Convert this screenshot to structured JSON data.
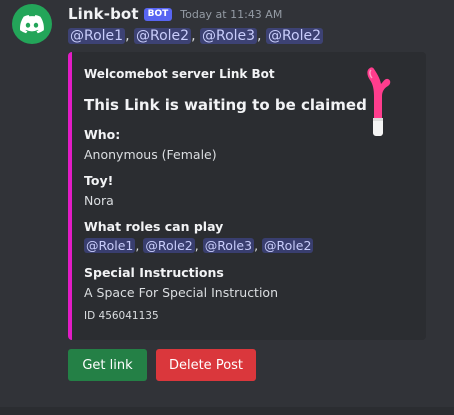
{
  "message": {
    "username": "Link-bot",
    "bot_badge": "BOT",
    "timestamp": "Today at 11:43 AM",
    "mentions": [
      "@Role1",
      "@Role2",
      "@Role3",
      "@Role2"
    ],
    "separator": ", "
  },
  "embed": {
    "accent_color": "#e21cc5",
    "author": "Welcomebot server Link Bot",
    "title": "This Link is waiting to be claimed",
    "fields": {
      "who": {
        "name": "Who:",
        "value": "Anonymous (Female)"
      },
      "toy": {
        "name": "Toy!",
        "value": "Nora"
      },
      "roles": {
        "name": "What roles can play",
        "mentions": [
          "@Role1",
          "@Role2",
          "@Role3",
          "@Role2"
        ]
      },
      "instructions": {
        "name": "Special Instructions",
        "value": "A Space For Special Instruction"
      }
    },
    "footer": "ID 456041135",
    "thumbnail_icon": "toy-thumbnail-image"
  },
  "buttons": {
    "get_link": "Get link",
    "delete_post": "Delete Post"
  },
  "colors": {
    "background": "#313338",
    "embed_bg": "#2b2d31",
    "mention_bg": "#3c4270",
    "mention_text": "#c9cdfb",
    "green": "#248046",
    "red": "#da373c",
    "bot_badge": "#5865f2",
    "avatar": "#23a559"
  }
}
